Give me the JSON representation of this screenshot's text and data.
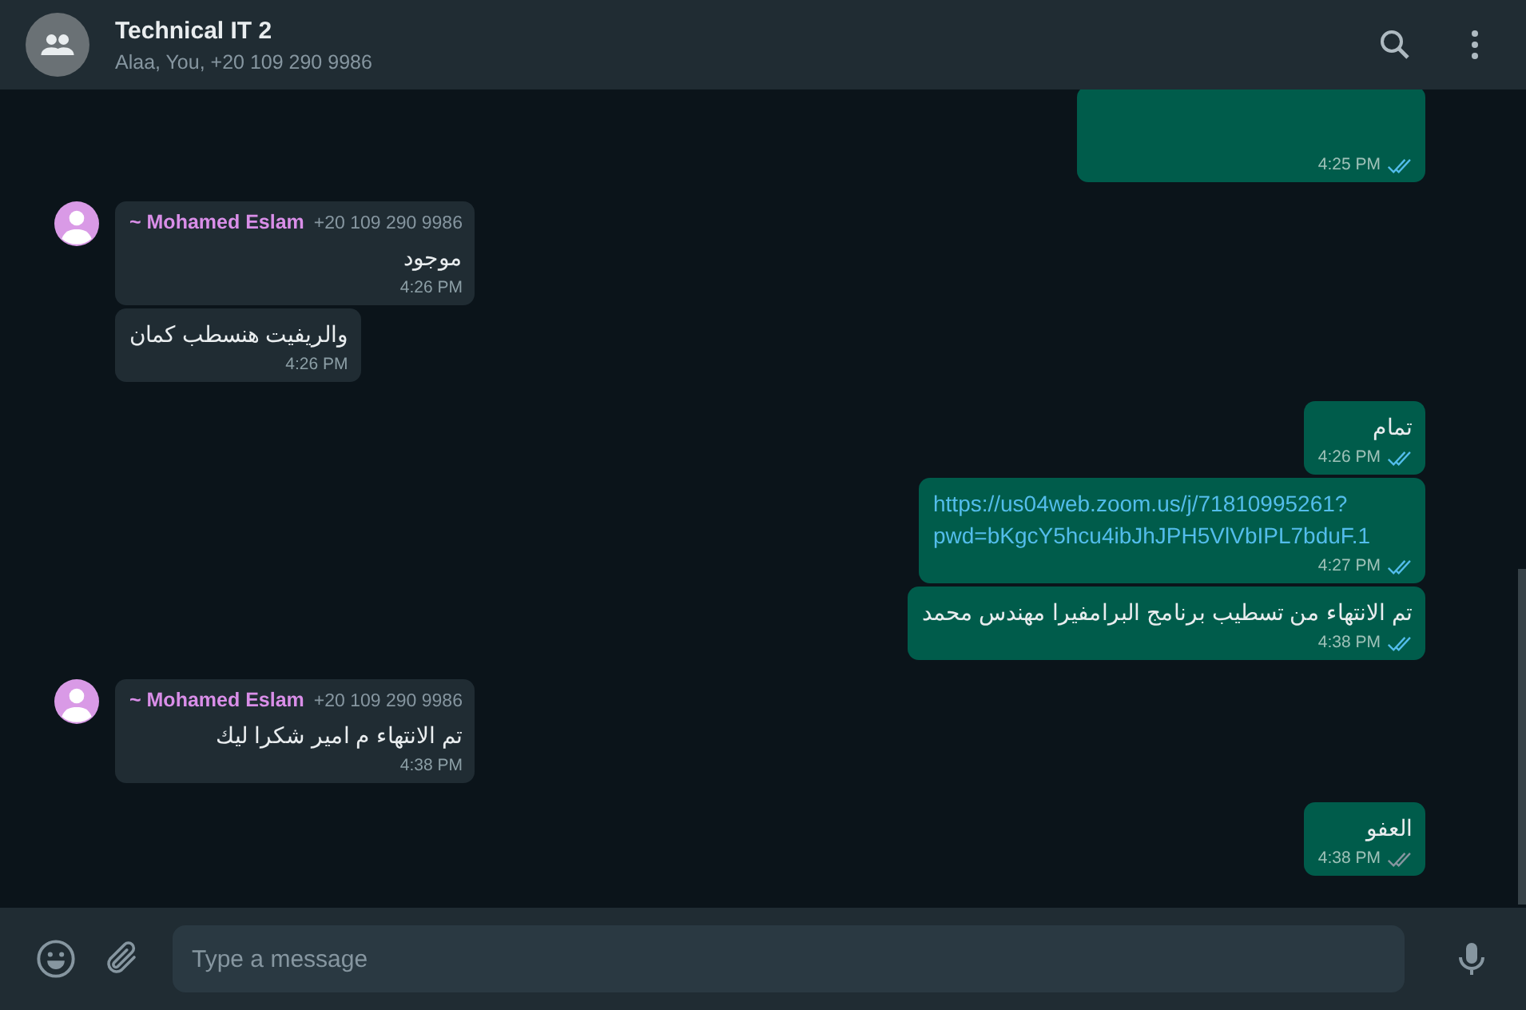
{
  "header": {
    "title": "Technical IT 2",
    "subtitle": "Alaa, You, +20 109 290 9986"
  },
  "messages": [
    {
      "kind": "out",
      "partial": true,
      "time": "4:25 PM",
      "read": true
    },
    {
      "kind": "in",
      "sender": "~ Mohamed Eslam",
      "phone": "+20 109 290 9986",
      "text": "موجود",
      "time": "4:26 PM"
    },
    {
      "kind": "in",
      "text": "والريفيت هنسطب كمان",
      "time": "4:26 PM"
    },
    {
      "kind": "out",
      "text": "تمام",
      "time": "4:26 PM",
      "read": true
    },
    {
      "kind": "out",
      "link": true,
      "text": "https://us04web.zoom.us/j/71810995261?pwd=bKgcY5hcu4ibJhJPH5VlVbIPL7bduF.1",
      "time": "4:27 PM",
      "read": true
    },
    {
      "kind": "out",
      "text": "تم الانتهاء من تسطيب برنامج البرامفيرا مهندس محمد",
      "time": "4:38 PM",
      "read": true
    },
    {
      "kind": "in",
      "sender": "~ Mohamed Eslam",
      "phone": "+20 109 290 9986",
      "text": "تم الانتهاء م امير شكرا ليك",
      "time": "4:38 PM"
    },
    {
      "kind": "out",
      "text": "العفو",
      "time": "4:38 PM",
      "read": false
    }
  ],
  "composer": {
    "placeholder": "Type a message"
  }
}
